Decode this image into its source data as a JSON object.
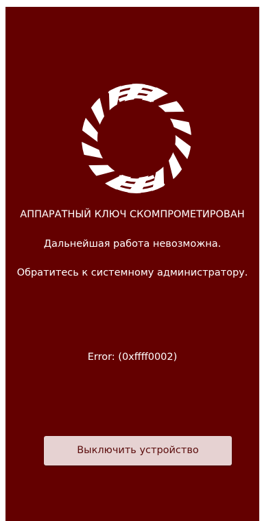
{
  "screen": {
    "background_color": "#640000",
    "logo_icon": "striped-ring-logo-icon"
  },
  "message": {
    "title": "АППАРАТНЫЙ КЛЮЧ СКОМПРОМЕТИРОВАН",
    "line1": "Дальнейшая работа невозможна.",
    "line2": "Обратитесь к системному администратору."
  },
  "error": {
    "text": "Error: (0xffff0002)"
  },
  "actions": {
    "power_off_label": "Выключить устройство"
  }
}
